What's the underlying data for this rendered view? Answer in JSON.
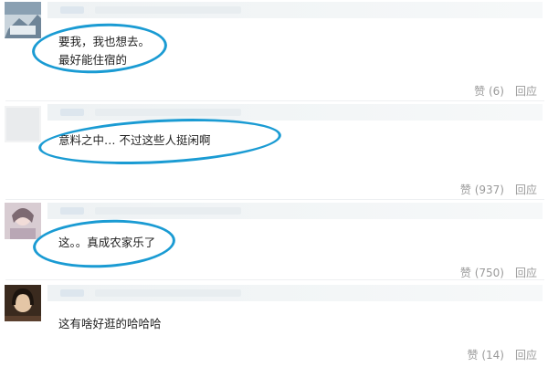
{
  "comments": [
    {
      "text": "要我，我也想去。\n最好能住宿的",
      "like_label": "赞 (6)",
      "reply_label": "回应"
    },
    {
      "text": "意料之中… 不过这些人挺闲啊",
      "like_label": "赞 (937)",
      "reply_label": "回应"
    },
    {
      "text": "这。。真成农家乐了",
      "like_label": "赞 (750)",
      "reply_label": "回应"
    },
    {
      "text": "这有啥好逛的哈哈哈",
      "like_label": "赞 (14)",
      "reply_label": "回应"
    }
  ],
  "annotation_color": "#1a9bd3"
}
